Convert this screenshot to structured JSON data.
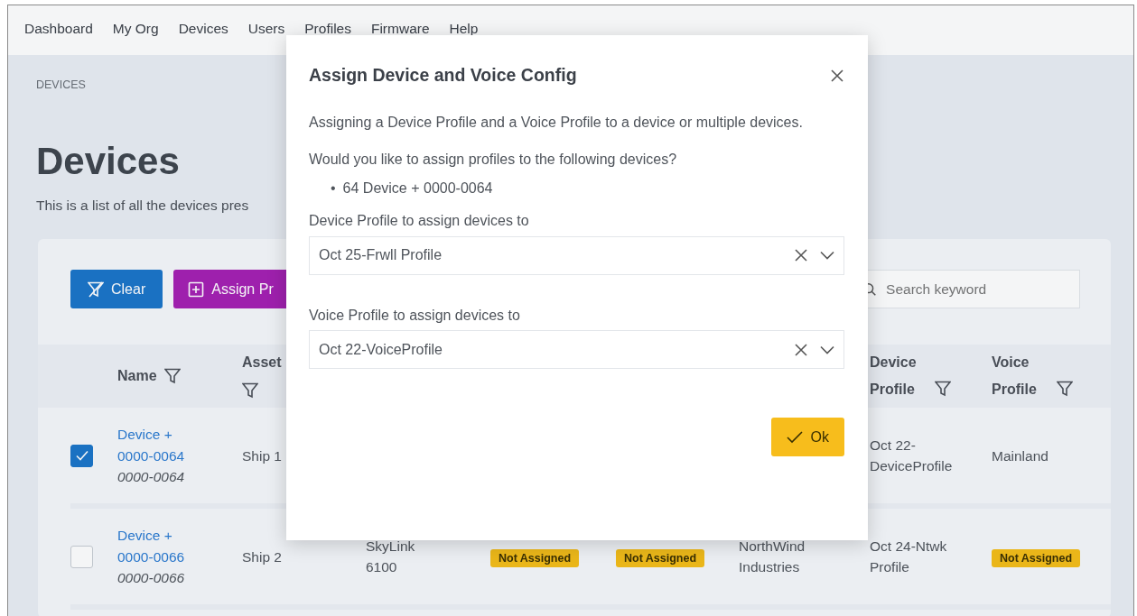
{
  "nav": {
    "items": [
      {
        "label": "Dashboard"
      },
      {
        "label": "My Org"
      },
      {
        "label": "Devices"
      },
      {
        "label": "Users"
      },
      {
        "label": "Profiles"
      },
      {
        "label": "Firmware"
      },
      {
        "label": "Help"
      }
    ]
  },
  "breadcrumb": "DEVICES",
  "page_title": "Devices",
  "description": "This is a list of all the devices pres",
  "toolbar": {
    "clear_button": "Clear",
    "assign_button": "Assign Pr",
    "search": {
      "placeholder": "Search keyword"
    }
  },
  "table": {
    "columns": [
      {
        "label": "Name"
      },
      {
        "label": "Asset"
      },
      {},
      {},
      {},
      {},
      {
        "label": "Device Profile"
      },
      {
        "label": "Voice Profile"
      }
    ],
    "rows": [
      {
        "checked": true,
        "name": "Device + 0000-0064",
        "serial": "0000-0064",
        "asset": {
          "kind": "text",
          "text": "Ship 1"
        },
        "device_profile": {
          "kind": "text",
          "text": "Oct 22-DeviceProfile"
        },
        "voice_profile": {
          "kind": "text",
          "text": "Mainland"
        }
      },
      {
        "checked": false,
        "name": "Device + 0000-0066",
        "serial": "0000-0066",
        "asset": {
          "kind": "text",
          "text": "Ship 2"
        },
        "column_3": {
          "kind": "text",
          "text": "SkyLink 6100"
        },
        "column_4": {
          "kind": "badge",
          "text": "Not Assigned"
        },
        "column_5": {
          "kind": "badge",
          "text": "Not Assigned"
        },
        "column_6": {
          "kind": "text",
          "text": "NorthWind Industries"
        },
        "device_profile": {
          "kind": "text",
          "text": "Oct 24-Ntwk Profile"
        },
        "voice_profile": {
          "kind": "badge",
          "text": "Not Assigned"
        }
      }
    ]
  },
  "modal": {
    "title": "Assign Device and Voice Config",
    "intro": "Assigning a Device Profile and a Voice Profile to a device or multiple devices.",
    "question": "Would you like to assign profiles to the following devices?",
    "devices": [
      {
        "marker": "•",
        "text": "64 Device + 0000-0064"
      }
    ],
    "fields": [
      {
        "label": "Device Profile to assign devices to",
        "value": "Oct 25-Frwll Profile"
      },
      {
        "label": "Voice Profile to assign devices to",
        "value": "Oct 22-VoiceProfile"
      }
    ],
    "ok_button": "Ok"
  }
}
